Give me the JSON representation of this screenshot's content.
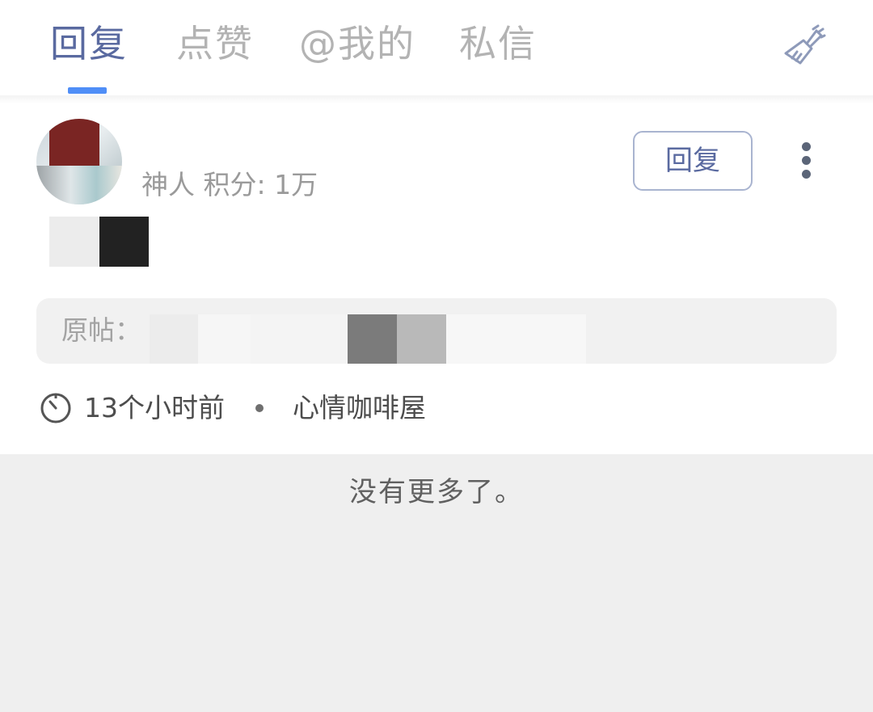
{
  "tabs": [
    {
      "label": "回复",
      "active": true
    },
    {
      "label": "点赞",
      "active": false
    },
    {
      "label": "@我的",
      "active": false
    },
    {
      "label": "私信",
      "active": false
    }
  ],
  "header": {
    "clean_icon": "broom-icon",
    "accent_color": "#4f8ef7",
    "active_tab_color": "#5a6aa0"
  },
  "notification": {
    "user_meta": "神人 积分: 1万",
    "reply_button_label": "回复",
    "more_icon": "more-vertical-icon",
    "original_post_label": "原帖：",
    "time": "13个小时前",
    "separator": "•",
    "forum": "心情咖啡屋"
  },
  "footer": {
    "no_more_text": "没有更多了。"
  }
}
